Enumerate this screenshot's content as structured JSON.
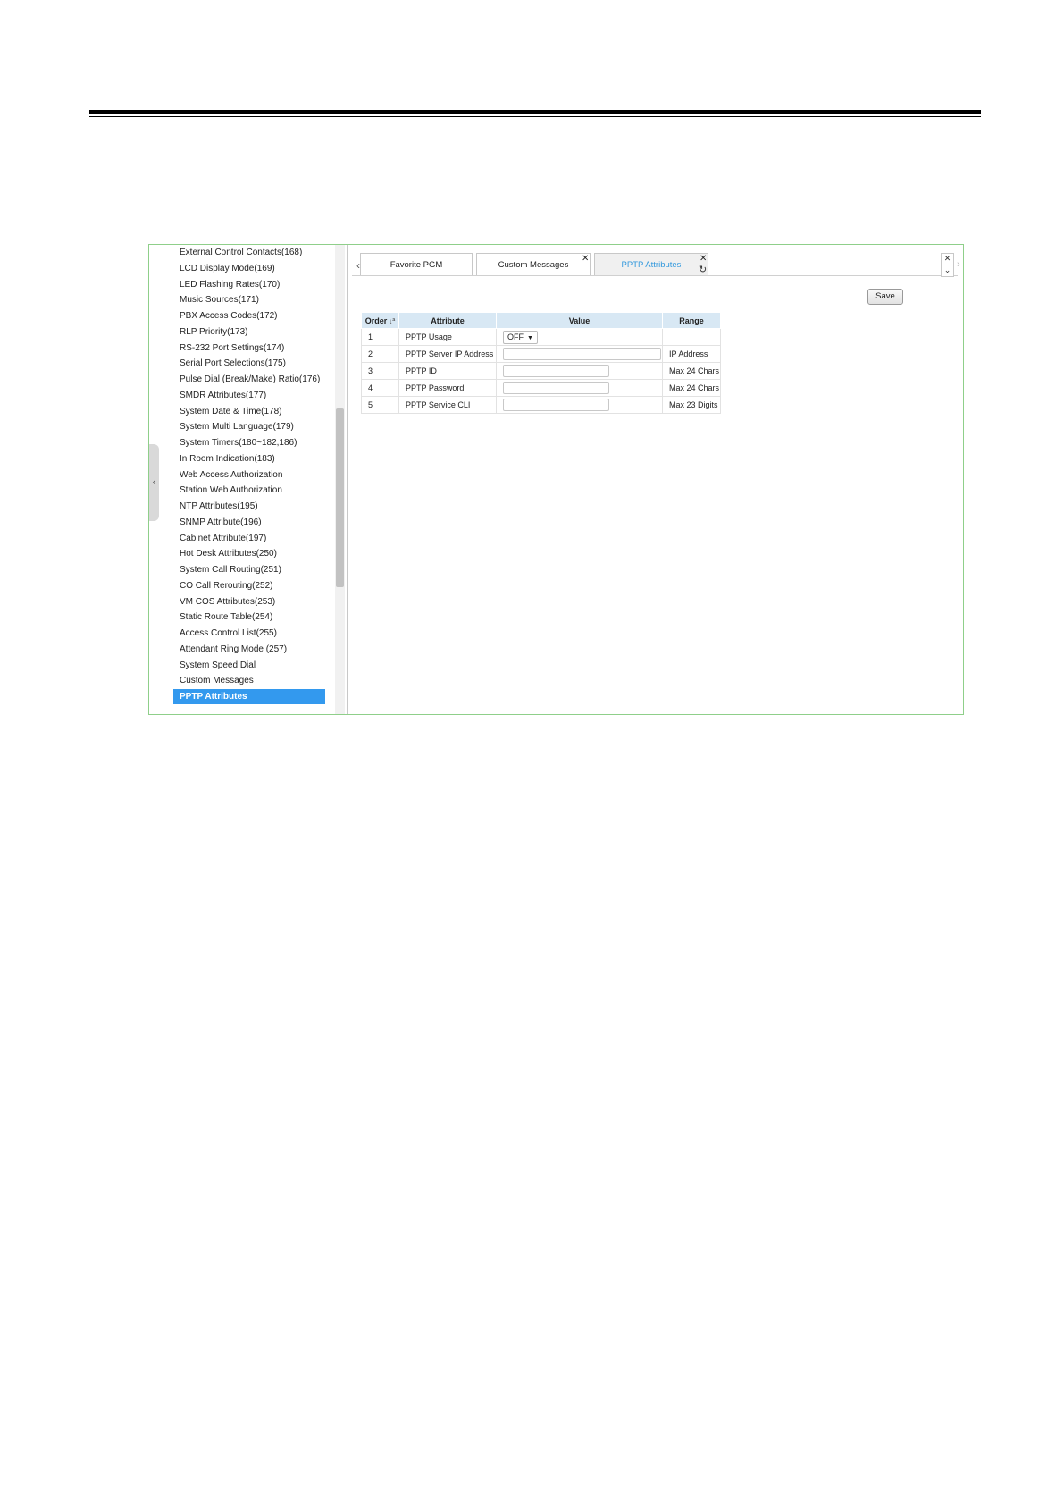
{
  "sidebar": {
    "items": [
      "External Control Contacts(168)",
      "LCD Display Mode(169)",
      "LED Flashing Rates(170)",
      "Music Sources(171)",
      "PBX Access Codes(172)",
      "RLP Priority(173)",
      "RS-232 Port Settings(174)",
      "Serial Port Selections(175)",
      "Pulse Dial (Break/Make) Ratio(176)",
      "SMDR Attributes(177)",
      "System Date & Time(178)",
      "System Multi Language(179)",
      "System Timers(180~182,186)",
      "In Room Indication(183)",
      "Web Access Authorization",
      "Station Web Authorization",
      "NTP Attributes(195)",
      "SNMP Attribute(196)",
      "Cabinet Attribute(197)",
      "Hot Desk Attributes(250)",
      "System Call Routing(251)",
      "CO Call Rerouting(252)",
      "VM COS Attributes(253)",
      "Static Route Table(254)",
      "Access Control List(255)",
      "Attendant Ring Mode (257)",
      "System Speed Dial",
      "Custom Messages",
      "PPTP Attributes"
    ],
    "active_item": "PPTP Attributes"
  },
  "tabs": [
    {
      "label": "Favorite PGM"
    },
    {
      "label": "Custom Messages"
    },
    {
      "label": "PPTP Attributes"
    }
  ],
  "icons": {
    "collapse": "chevron-left-icon",
    "tab_prev": "chevron-left-icon",
    "tab_next": "chevron-right-icon",
    "close": "close-icon",
    "refresh": "refresh-icon",
    "sort": "sort-icon",
    "dropdown": "caret-down-icon"
  },
  "glyphs": {
    "collapse": "‹",
    "prev": "‹",
    "next": "›",
    "close": "✕",
    "refresh": "↻",
    "down": "⌄",
    "sort": "↓ª",
    "caret": "▼"
  },
  "toolbar": {
    "save_label": "Save"
  },
  "table": {
    "headers": {
      "order": "Order",
      "attribute": "Attribute",
      "value": "Value",
      "range": "Range"
    },
    "rows": [
      {
        "order": "1",
        "attribute": "PPTP Usage",
        "value": "OFF",
        "value_type": "select",
        "range": ""
      },
      {
        "order": "2",
        "attribute": "PPTP Server IP Address",
        "value": "",
        "value_type": "text",
        "range": "IP Address"
      },
      {
        "order": "3",
        "attribute": "PPTP ID",
        "value": "",
        "value_type": "text",
        "range": "Max 24 Chars"
      },
      {
        "order": "4",
        "attribute": "PPTP Password",
        "value": "",
        "value_type": "text",
        "range": "Max 24 Chars"
      },
      {
        "order": "5",
        "attribute": "PPTP Service CLI",
        "value": "",
        "value_type": "text",
        "range": "Max 23 Digits"
      }
    ]
  },
  "colors": {
    "accent": "#3399ee",
    "frame_border": "#8fcf8a",
    "table_header": "#d8e8f4",
    "active_tab_text": "#3399dd"
  }
}
